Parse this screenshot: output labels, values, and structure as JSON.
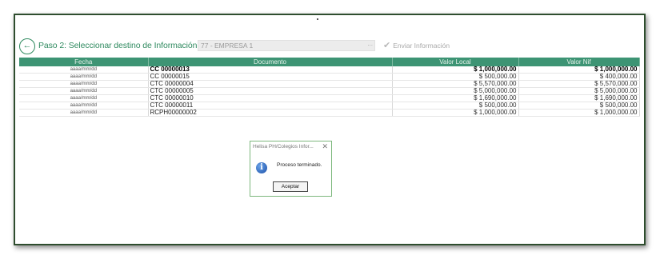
{
  "toolbar": {
    "back_icon": "back-arrow-icon",
    "step_label": "Paso 2: Seleccionar destino de Información...",
    "select_value": "77 - EMPRESA 1",
    "select_dots": "...",
    "send_label": "Enviar Información",
    "send_icon": "check-icon"
  },
  "table": {
    "headers": [
      "Fecha",
      "Documento",
      "Valor Local",
      "Valor Nif"
    ],
    "rows": [
      {
        "fecha": "aaaa/mm/dd",
        "documento": "CC  00000013",
        "valor_local": "$ 1,000,000.00",
        "valor_nif": "$ 1,000,000.00"
      },
      {
        "fecha": "aaaa/mm/dd",
        "documento": "CC  00000015",
        "valor_local": "$ 500,000.00",
        "valor_nif": "$ 400,000.00"
      },
      {
        "fecha": "aaaa/mm/dd",
        "documento": "CTC 00000004",
        "valor_local": "$ 5,570,000.00",
        "valor_nif": "$ 5,570,000.00"
      },
      {
        "fecha": "aaaa/mm/dd",
        "documento": "CTC 00000005",
        "valor_local": "$ 5,000,000.00",
        "valor_nif": "$ 5,000,000.00"
      },
      {
        "fecha": "aaaa/mm/dd",
        "documento": "CTC 00000010",
        "valor_local": "$ 1,690,000.00",
        "valor_nif": "$ 1,690,000.00"
      },
      {
        "fecha": "aaaa/mm/dd",
        "documento": "CTC 00000011",
        "valor_local": "$ 500,000.00",
        "valor_nif": "$ 500,000.00"
      },
      {
        "fecha": "aaaa/mm/dd",
        "documento": "RCPH00000002",
        "valor_local": "$ 1,000,000.00",
        "valor_nif": "$ 1,000,000.00"
      }
    ]
  },
  "dialog": {
    "title": "Helisa PH/Colegios Infor...",
    "close": "✕",
    "icon": "info-icon",
    "message": "Proceso terminado.",
    "ok_label": "Aceptar"
  }
}
